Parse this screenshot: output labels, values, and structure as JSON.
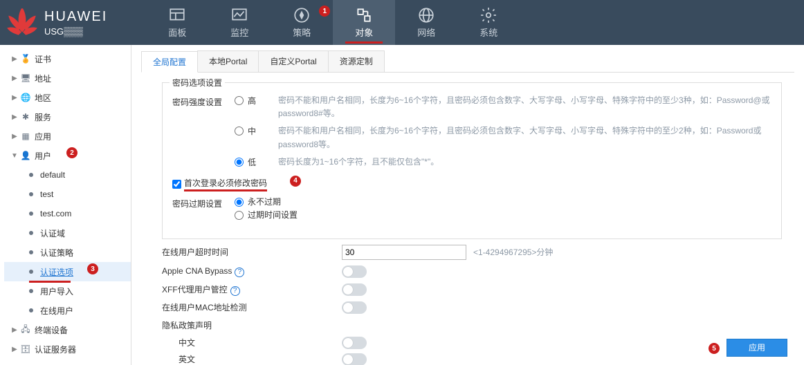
{
  "brand": "HUAWEI",
  "model": "USG▒▒▒",
  "nav": [
    {
      "label": "面板"
    },
    {
      "label": "监控"
    },
    {
      "label": "策略"
    },
    {
      "label": "对象"
    },
    {
      "label": "网络"
    },
    {
      "label": "系统"
    }
  ],
  "sidebar": {
    "items": [
      {
        "label": "证书"
      },
      {
        "label": "地址"
      },
      {
        "label": "地区"
      },
      {
        "label": "服务"
      },
      {
        "label": "应用"
      },
      {
        "label": "用户",
        "children": [
          {
            "label": "default"
          },
          {
            "label": "test"
          },
          {
            "label": "test.com"
          },
          {
            "label": "认证域"
          },
          {
            "label": "认证策略"
          },
          {
            "label": "认证选项"
          },
          {
            "label": "用户导入"
          },
          {
            "label": "在线用户"
          }
        ]
      },
      {
        "label": "终端设备"
      },
      {
        "label": "认证服务器"
      }
    ]
  },
  "tabs": [
    {
      "label": "全局配置"
    },
    {
      "label": "本地Portal"
    },
    {
      "label": "自定义Portal"
    },
    {
      "label": "资源定制"
    }
  ],
  "password_panel": {
    "legend": "密码选项设置",
    "strength_label": "密码强度设置",
    "options": {
      "high": {
        "label": "高",
        "desc": "密码不能和用户名相同，长度为6~16个字符，且密码必须包含数字、大写字母、小写字母、特殊字符中的至少3种，如：Password@或password8#等。"
      },
      "mid": {
        "label": "中",
        "desc": "密码不能和用户名相同，长度为6~16个字符，且密码必须包含数字、大写字母、小写字母、特殊字符中的至少2种，如：Password或password8等。"
      },
      "low": {
        "label": "低",
        "desc": "密码长度为1~16个字符，且不能仅包含\"*\"。"
      }
    },
    "first_login_change": "首次登录必须修改密码",
    "expire_label": "密码过期设置",
    "expire_never": "永不过期",
    "expire_time": "过期时间设置"
  },
  "settings": {
    "online_timeout_label": "在线用户超时时间",
    "online_timeout_value": "30",
    "online_timeout_hint": "<1-4294967295>分钟",
    "apple_cna": "Apple CNA Bypass",
    "xff": "XFF代理用户管控",
    "mac_check": "在线用户MAC地址检测",
    "privacy": "隐私政策声明",
    "chinese": "中文",
    "english": "英文"
  },
  "apply": "应用",
  "badges": {
    "b1": "1",
    "b2": "2",
    "b3": "3",
    "b4": "4",
    "b5": "5"
  }
}
